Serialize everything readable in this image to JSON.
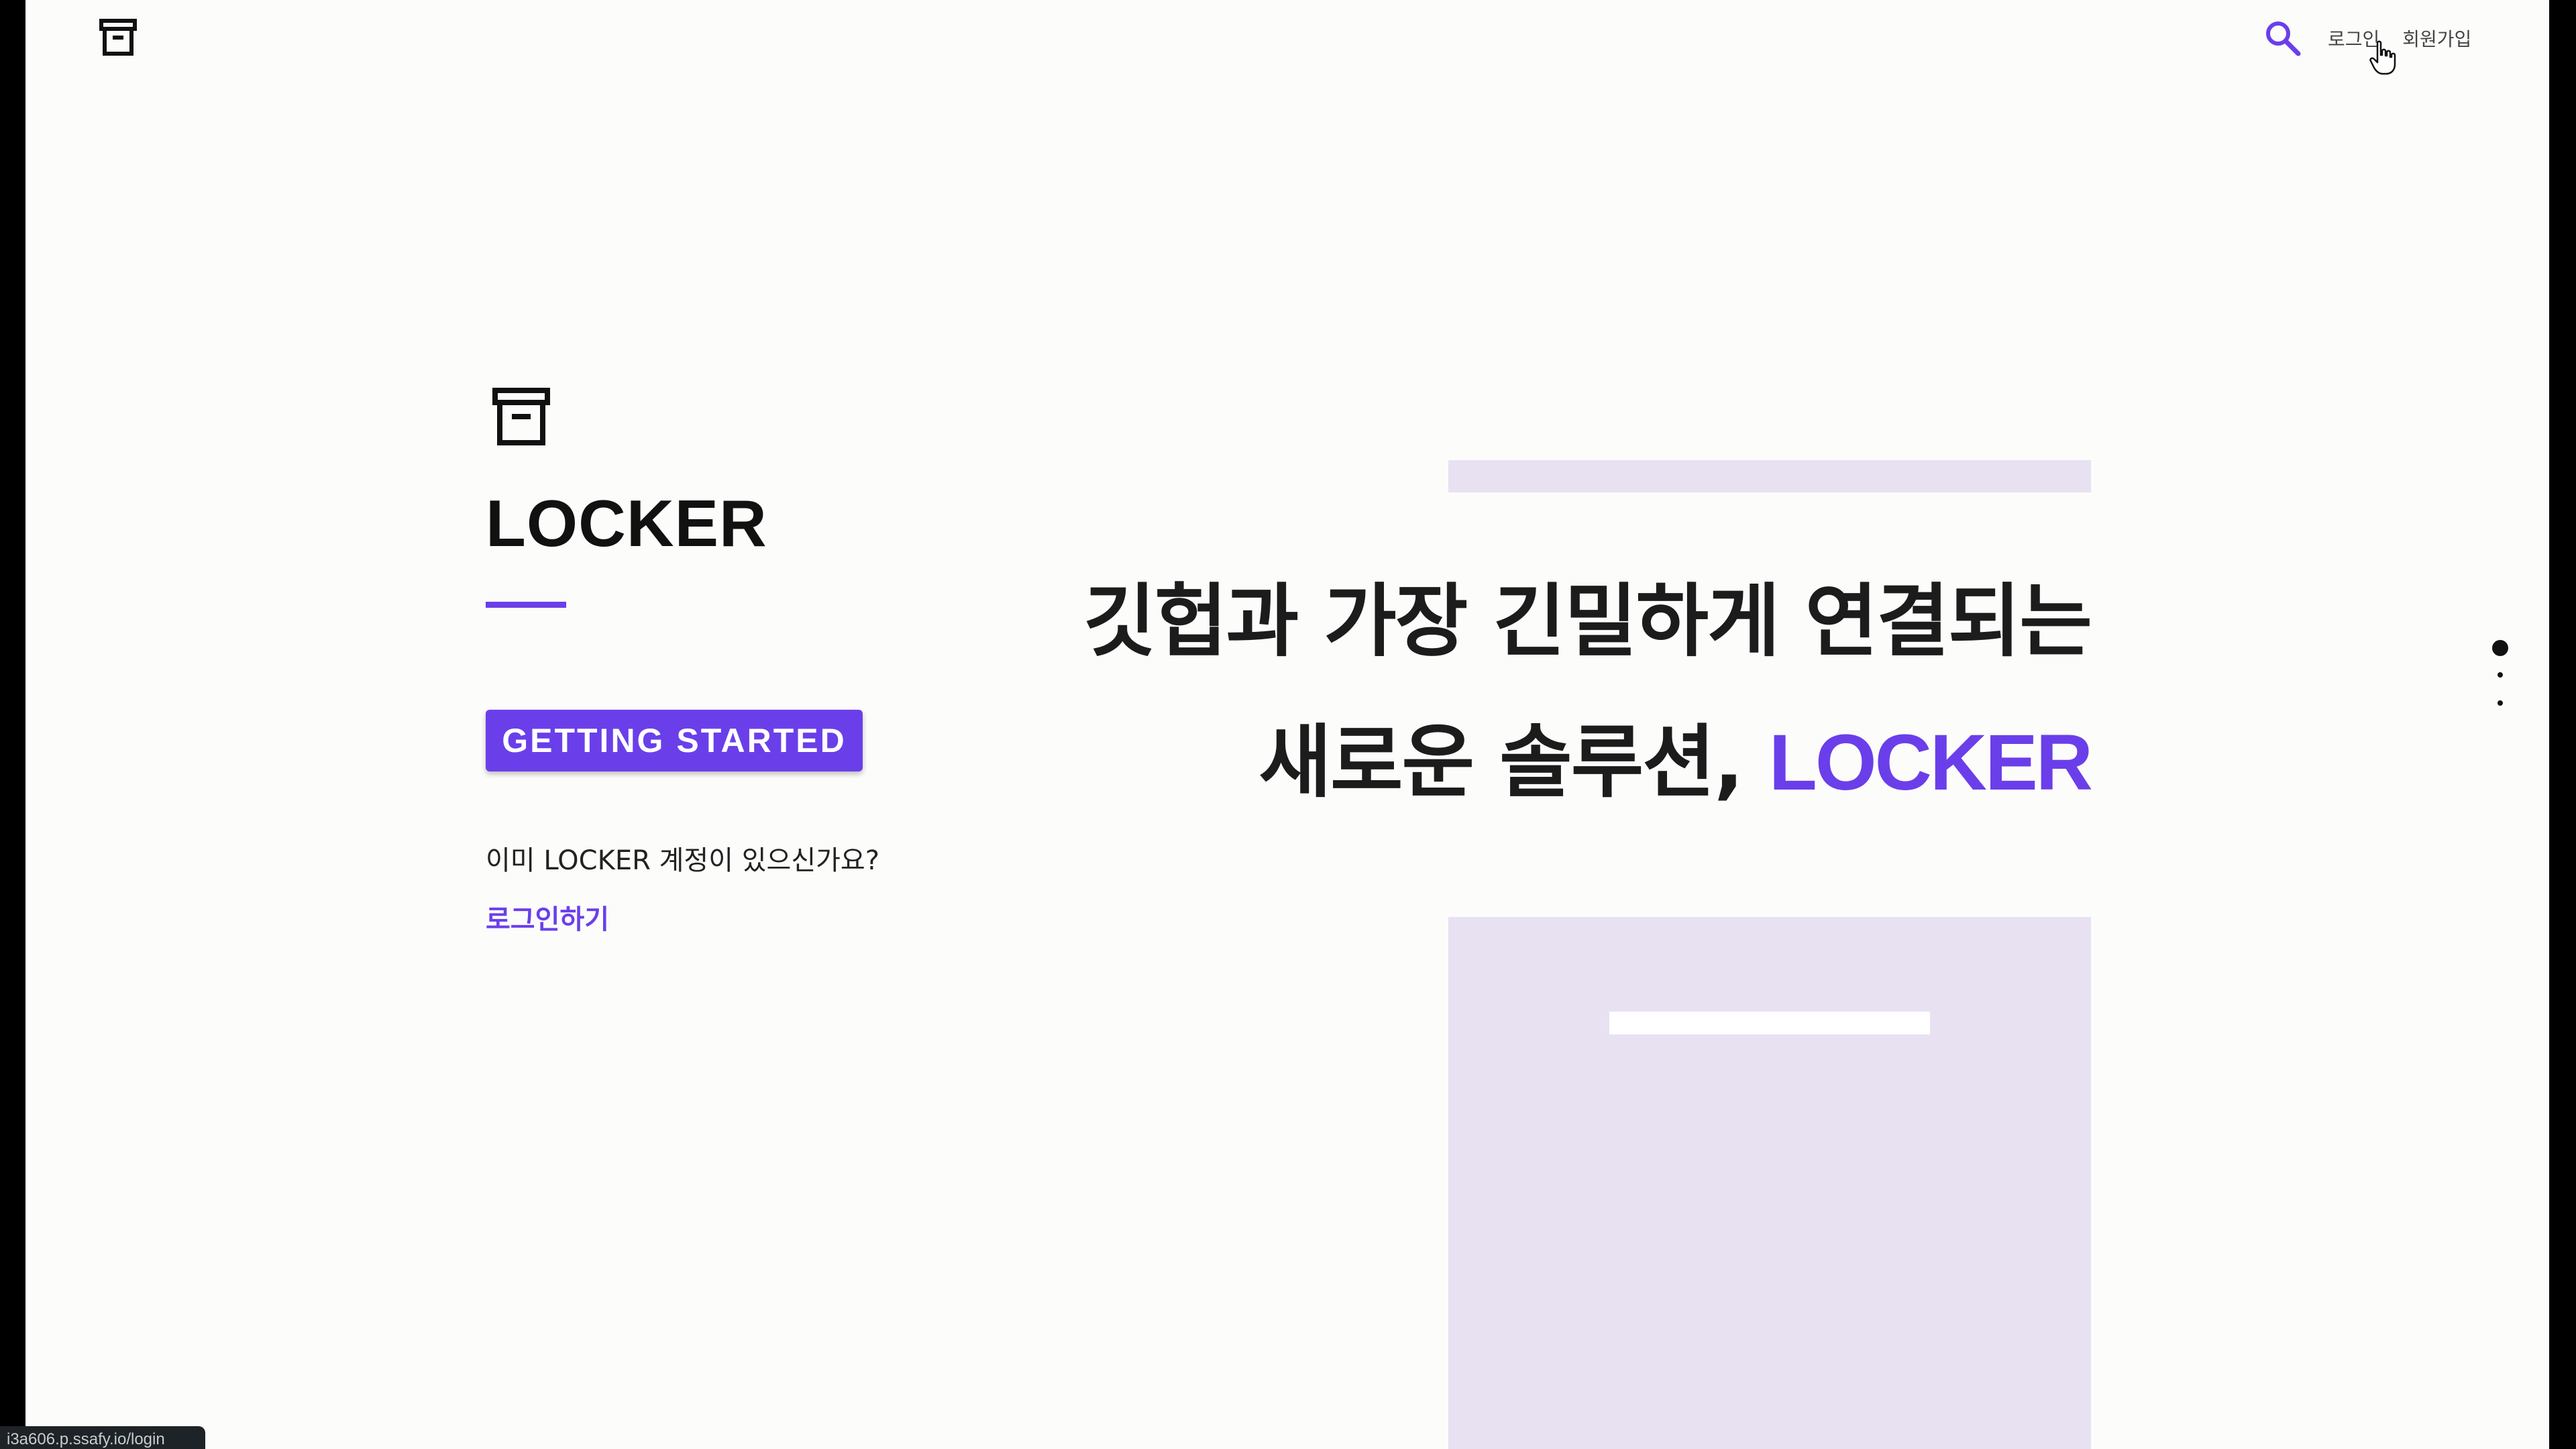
{
  "header": {
    "logo_icon": "archive-box-icon",
    "search_icon": "search-icon",
    "login_label": "로그인",
    "signup_label": "회원가입"
  },
  "hero": {
    "logo_icon": "archive-box-icon",
    "brand": "LOCKER",
    "cta_label": "GETTING STARTED",
    "account_question": "이미 LOCKER 계정이 있으신가요?",
    "login_link": "로그인하기",
    "headline_line1": "깃헙과 가장 긴밀하게 연결되는",
    "headline_line2_prefix": "새로운 솔루션, ",
    "headline_line2_accent": "LOCKER"
  },
  "pager": {
    "total": 3,
    "active": 1
  },
  "status_bar": {
    "url": "i3a606.p.ssafy.io/login"
  },
  "colors": {
    "accent": "#6a3fea",
    "decor": "#e8e1f2",
    "background": "#fcfcfb"
  }
}
